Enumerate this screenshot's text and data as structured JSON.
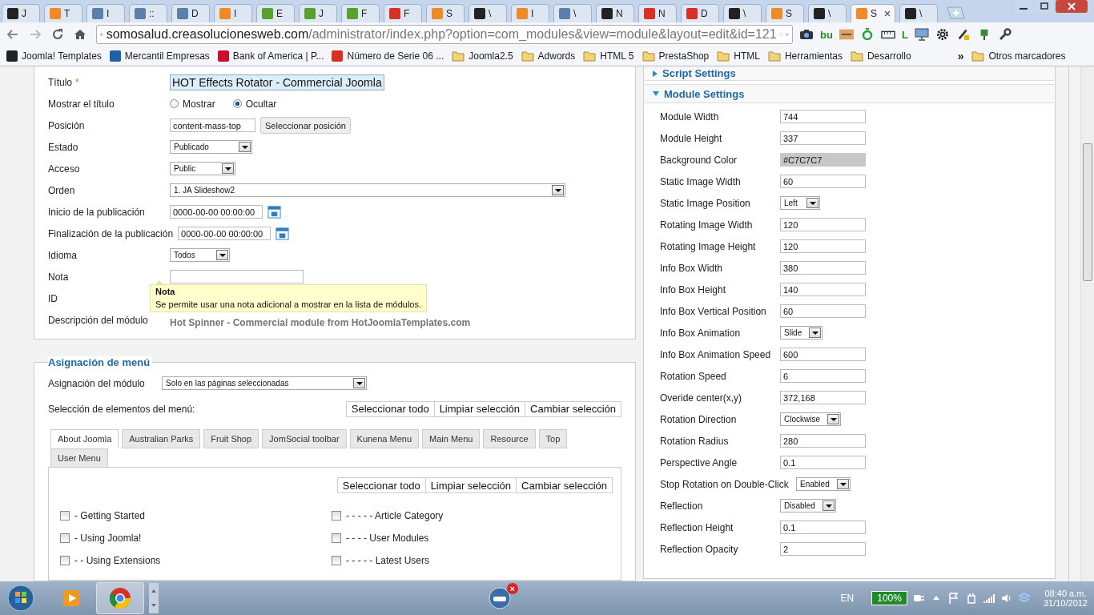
{
  "browser": {
    "tabs": [
      {
        "title": "J",
        "color": "#222222",
        "selected": false
      },
      {
        "title": "T",
        "color": "#f08a24",
        "selected": false
      },
      {
        "title": "I",
        "color": "#5a7fa8",
        "selected": false
      },
      {
        "title": "::",
        "color": "#5a7fa8",
        "selected": false
      },
      {
        "title": "D",
        "color": "#5a7fa8",
        "selected": false
      },
      {
        "title": "I",
        "color": "#f08a24",
        "selected": false
      },
      {
        "title": "E",
        "color": "#5aa02c",
        "selected": false
      },
      {
        "title": "J",
        "color": "#5aa02c",
        "selected": false
      },
      {
        "title": "F",
        "color": "#5aa02c",
        "selected": false
      },
      {
        "title": "F",
        "color": "#d93025",
        "selected": false
      },
      {
        "title": "S",
        "color": "#f08a24",
        "selected": false
      },
      {
        "title": "\\",
        "color": "#222222",
        "selected": false
      },
      {
        "title": "I",
        "color": "#f08a24",
        "selected": false
      },
      {
        "title": "\\",
        "color": "#5a7fa8",
        "selected": false
      },
      {
        "title": "N",
        "color": "#222222",
        "selected": false
      },
      {
        "title": "N",
        "color": "#d93025",
        "selected": false
      },
      {
        "title": "D",
        "color": "#d93025",
        "selected": false
      },
      {
        "title": "\\",
        "color": "#222222",
        "selected": false
      },
      {
        "title": "S",
        "color": "#f08a24",
        "selected": false
      },
      {
        "title": "\\",
        "color": "#222222",
        "selected": false
      },
      {
        "title": "S",
        "color": "#f08a24",
        "selected": true
      },
      {
        "title": "\\",
        "color": "#222222",
        "selected": false
      }
    ],
    "url_host": "somosalud.creasolucionesweb.com",
    "url_path": "/administrator/index.php?option=com_modules&view=module&layout=edit&id=121",
    "extensions": [
      {
        "kind": "camera"
      },
      {
        "kind": "label",
        "label": "bu"
      },
      {
        "kind": "bar"
      },
      {
        "kind": "ring"
      },
      {
        "kind": "ruler"
      },
      {
        "kind": "label",
        "label": "L"
      },
      {
        "kind": "monitor"
      },
      {
        "kind": "gear"
      },
      {
        "kind": "pen"
      },
      {
        "kind": "plug"
      },
      {
        "kind": "wrench"
      }
    ],
    "bookmarks": [
      {
        "kind": "site",
        "label": "Joomla! Templates",
        "color": "#222222"
      },
      {
        "kind": "site",
        "label": "Mercantil Empresas",
        "color": "#1f5fa8"
      },
      {
        "kind": "site",
        "label": "Bank of America | P...",
        "color": "#c8102e"
      },
      {
        "kind": "site",
        "label": "Número de Serie 06 ...",
        "color": "#d93025"
      },
      {
        "kind": "folder",
        "label": "Joomla2.5"
      },
      {
        "kind": "folder",
        "label": "Adwords"
      },
      {
        "kind": "folder",
        "label": "HTML 5"
      },
      {
        "kind": "folder",
        "label": "PrestaShop"
      },
      {
        "kind": "folder",
        "label": "HTML"
      },
      {
        "kind": "folder",
        "label": "Herramientas"
      },
      {
        "kind": "folder",
        "label": "Desarrollo"
      }
    ],
    "more": "»",
    "other": "Otros marcadores"
  },
  "details": {
    "fields": [
      {
        "kind": "title",
        "label": "Título",
        "required": "*",
        "value": "HOT Effects Rotator - Commercial Joomla"
      },
      {
        "kind": "radio",
        "label": "Mostrar el título",
        "options": [
          {
            "label": "Mostrar",
            "selected": false
          },
          {
            "label": "Ocultar",
            "selected": true
          }
        ]
      },
      {
        "kind": "position",
        "label": "Posición",
        "value": "content-mass-top",
        "button": "Seleccionar posición"
      },
      {
        "kind": "select",
        "label": "Estado",
        "value": "Publicado"
      },
      {
        "kind": "select",
        "label": "Acceso",
        "value": "Public"
      },
      {
        "kind": "wide-select",
        "label": "Orden",
        "value": "1. JA Slideshow2"
      },
      {
        "kind": "date",
        "label": "Inicio de la publicación",
        "value": "0000-00-00 00:00:00"
      },
      {
        "kind": "date",
        "label": "Finalización de la publicación",
        "value": "0000-00-00 00:00:00"
      },
      {
        "kind": "select",
        "label": "Idioma",
        "value": "Todos"
      },
      {
        "kind": "text",
        "label": "Nota"
      },
      {
        "kind": "plain",
        "label": "ID"
      },
      {
        "kind": "plain",
        "label": "Descripción del módulo",
        "value": "Hot Spinner - Commercial module from HotJoomlaTemplates.com"
      }
    ],
    "tooltip": {
      "title": "Nota",
      "text": "Se permite usar una nota adicional a mostrar en la lista de módulos."
    }
  },
  "menu_assignment": {
    "legend": "Asignación de menú",
    "assign_label": "Asignación del módulo",
    "assign_value": "Solo en las páginas seleccionadas",
    "items_label": "Selección de elementos del menú:",
    "buttons": [
      "Seleccionar todo",
      "Limpiar selección",
      "Cambiar selección"
    ],
    "tabs": [
      {
        "label": "About Joomla",
        "selected": true
      },
      {
        "label": "Australian Parks",
        "selected": false
      },
      {
        "label": "Fruit Shop",
        "selected": false
      },
      {
        "label": "JomSocial toolbar",
        "selected": false
      },
      {
        "label": "Kunena Menu",
        "selected": false
      },
      {
        "label": "Main Menu",
        "selected": false
      },
      {
        "label": "Resource",
        "selected": false
      },
      {
        "label": "Top",
        "selected": false
      },
      {
        "label": "User Menu",
        "selected": false
      }
    ],
    "inner_buttons": [
      "Seleccionar todo",
      "Limpiar selección",
      "Cambiar selección"
    ],
    "items": [
      {
        "label": "- Getting Started",
        "checked": false
      },
      {
        "label": "- - - - - Article Category",
        "checked": false
      },
      {
        "label": "- Using Joomla!",
        "checked": false
      },
      {
        "label": "- - - - User Modules",
        "checked": false
      },
      {
        "label": "- - Using Extensions",
        "checked": false
      },
      {
        "label": "- - - - - Latest Users",
        "checked": false
      }
    ]
  },
  "settings": {
    "collapsed_title": "Script Settings",
    "title": "Module Settings",
    "expanded": true,
    "rows": [
      {
        "kind": "text",
        "label": "Module Width",
        "value": "744"
      },
      {
        "kind": "text",
        "label": "Module Height",
        "value": "337"
      },
      {
        "kind": "color",
        "label": "Background Color",
        "value": "#C7C7C7"
      },
      {
        "kind": "text",
        "label": "Static Image Width",
        "value": "60"
      },
      {
        "kind": "select",
        "label": "Static Image Position",
        "value": "Left"
      },
      {
        "kind": "text",
        "label": "Rotating Image Width",
        "value": "120"
      },
      {
        "kind": "text",
        "label": "Rotating Image Height",
        "value": "120"
      },
      {
        "kind": "text",
        "label": "Info Box Width",
        "value": "380"
      },
      {
        "kind": "text",
        "label": "Info Box Height",
        "value": "140"
      },
      {
        "kind": "text",
        "label": "Info Box Vertical Position",
        "value": "60"
      },
      {
        "kind": "select",
        "label": "Info Box Animation",
        "value": "Slide"
      },
      {
        "kind": "text",
        "label": "Info Box Animation Speed",
        "value": "600"
      },
      {
        "kind": "text",
        "label": "Rotation Speed",
        "value": "6"
      },
      {
        "kind": "text",
        "label": "Overide center(x,y)",
        "value": "372,168"
      },
      {
        "kind": "select",
        "label": "Rotation Direction",
        "value": "Clockwise"
      },
      {
        "kind": "text",
        "label": "Rotation Radius",
        "value": "280"
      },
      {
        "kind": "text",
        "label": "Perspective Angle",
        "value": "0.1"
      },
      {
        "kind": "select",
        "label": "Stop Rotation on Double-Click",
        "value": "Enabled"
      },
      {
        "kind": "select",
        "label": "Reflection",
        "value": "Disabled"
      },
      {
        "kind": "text",
        "label": "Reflection Height",
        "value": "0.1"
      },
      {
        "kind": "text",
        "label": "Reflection Opacity",
        "value": "2"
      }
    ]
  },
  "taskbar": {
    "badge": "×",
    "language": "EN",
    "battery": "100%",
    "time": "08:40 a.m.",
    "date": "31/10/2012"
  }
}
